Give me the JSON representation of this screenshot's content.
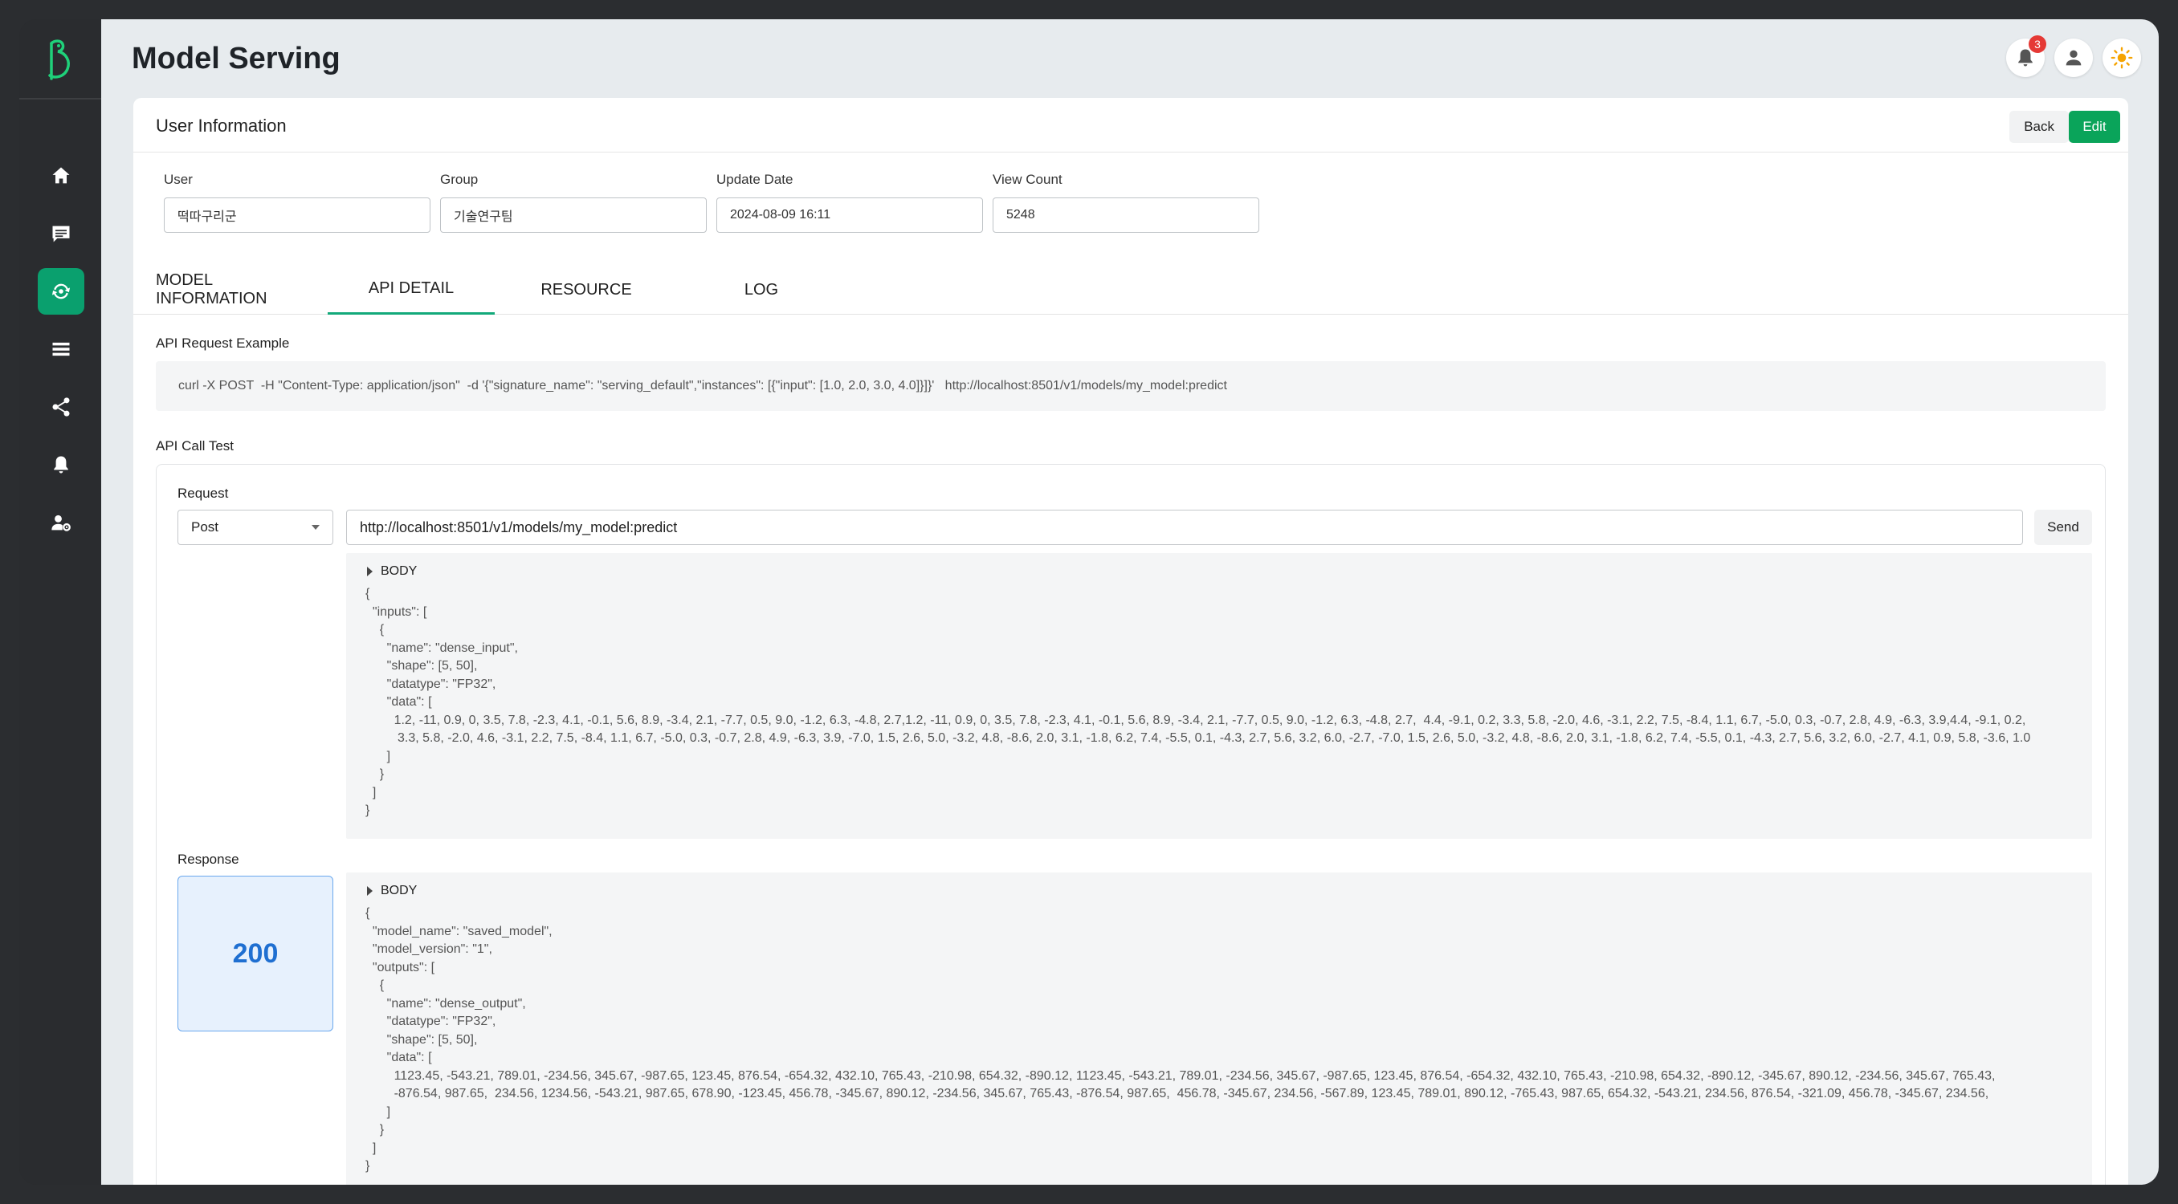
{
  "page": {
    "title": "Model Serving"
  },
  "notifications": {
    "count": "3"
  },
  "card": {
    "title": "User Information",
    "back_label": "Back",
    "edit_label": "Edit"
  },
  "fields": {
    "user": {
      "label": "User",
      "value": "떡따구리군"
    },
    "group": {
      "label": "Group",
      "value": "기술연구팀"
    },
    "update_date": {
      "label": "Update Date",
      "value": "2024-08-09 16:11"
    },
    "view_count": {
      "label": "View Count",
      "value": "5248"
    }
  },
  "tabs": [
    {
      "label": "MODEL INFORMATION"
    },
    {
      "label": "API DETAIL",
      "active": true
    },
    {
      "label": "RESOURCE"
    },
    {
      "label": "LOG"
    }
  ],
  "api_request": {
    "label": "API Request Example",
    "curl": "curl -X POST  -H \"Content-Type: application/json\"  -d '{\"signature_name\": \"serving_default\",\"instances\": [{\"input\": [1.0, 2.0, 3.0, 4.0]}]}'   http://localhost:8501/v1/models/my_model:predict"
  },
  "api_test": {
    "label": "API Call Test",
    "request_label": "Request",
    "method": "Post",
    "url": "http://localhost:8501/v1/models/my_model:predict",
    "send_label": "Send",
    "body_label": "BODY",
    "request_body": "{\n  \"inputs\": [\n    {\n      \"name\": \"dense_input\",\n      \"shape\": [5, 50],\n      \"datatype\": \"FP32\",\n      \"data\": [\n        1.2, -11, 0.9, 0, 3.5, 7.8, -2.3, 4.1, -0.1, 5.6, 8.9, -3.4, 2.1, -7.7, 0.5, 9.0, -1.2, 6.3, -4.8, 2.7,1.2, -11, 0.9, 0, 3.5, 7.8, -2.3, 4.1, -0.1, 5.6, 8.9, -3.4, 2.1, -7.7, 0.5, 9.0, -1.2, 6.3, -4.8, 2.7,  4.4, -9.1, 0.2, 3.3, 5.8, -2.0, 4.6, -3.1, 2.2, 7.5, -8.4, 1.1, 6.7, -5.0, 0.3, -0.7, 2.8, 4.9, -6.3, 3.9,4.4, -9.1, 0.2,\n         3.3, 5.8, -2.0, 4.6, -3.1, 2.2, 7.5, -8.4, 1.1, 6.7, -5.0, 0.3, -0.7, 2.8, 4.9, -6.3, 3.9, -7.0, 1.5, 2.6, 5.0, -3.2, 4.8, -8.6, 2.0, 3.1, -1.8, 6.2, 7.4, -5.5, 0.1, -4.3, 2.7, 5.6, 3.2, 6.0, -2.7, -7.0, 1.5, 2.6, 5.0, -3.2, 4.8, -8.6, 2.0, 3.1, -1.8, 6.2, 7.4, -5.5, 0.1, -4.3, 2.7, 5.6, 3.2, 6.0, -2.7, 4.1, 0.9, 5.8, -3.6, 1.0\n      ]\n    }\n  ]\n}",
    "response_label": "Response",
    "status_code": "200",
    "response_body": "{\n  \"model_name\": \"saved_model\",\n  \"model_version\": \"1\",\n  \"outputs\": [\n    {\n      \"name\": \"dense_output\",\n      \"datatype\": \"FP32\",\n      \"shape\": [5, 50],\n      \"data\": [\n        1123.45, -543.21, 789.01, -234.56, 345.67, -987.65, 123.45, 876.54, -654.32, 432.10, 765.43, -210.98, 654.32, -890.12, 1123.45, -543.21, 789.01, -234.56, 345.67, -987.65, 123.45, 876.54, -654.32, 432.10, 765.43, -210.98, 654.32, -890.12, -345.67, 890.12, -234.56, 345.67, 765.43,\n        -876.54, 987.65,  234.56, 1234.56, -543.21, 987.65, 678.90, -123.45, 456.78, -345.67, 890.12, -234.56, 345.67, 765.43, -876.54, 987.65,  456.78, -345.67, 234.56, -567.89, 123.45, 789.01, 890.12, -765.43, 987.65, 654.32, -543.21, 234.56, 876.54, -321.09, 456.78, -345.67, 234.56,\n      ]\n    }\n  ]\n}"
  },
  "colors": {
    "accent": "#0aa06e",
    "edit_button": "#0aa45a",
    "status_text": "#1f6fd1",
    "status_bg": "#e7f1fd"
  }
}
